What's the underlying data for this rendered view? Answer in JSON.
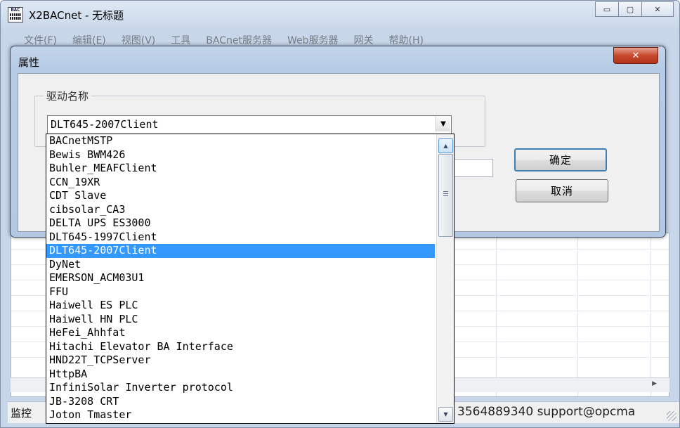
{
  "window": {
    "title": "X2BACnet - 无标题",
    "icon": "bac-app-icon",
    "icon_text": "BAC",
    "caption_buttons": {
      "minimize": "▭",
      "maximize": "▢",
      "close": "✕"
    }
  },
  "menubar": {
    "items": [
      "文件(F)",
      "编辑(E)",
      "视图(V)",
      "工具",
      "BACnet服务器",
      "Web服务器",
      "网关",
      "帮助(H)"
    ]
  },
  "statusbar": {
    "left": "监控",
    "right": "3564889340 support@opcma"
  },
  "dialog": {
    "title": "属性",
    "close_label": "✕",
    "group_label": "驱动名称",
    "combo_value": "DLT645-2007Client",
    "combo_arrow": "▼",
    "ok_label": "确定",
    "cancel_label": "取消"
  },
  "dropdown": {
    "selected_index": 8,
    "scroll_up": "▲",
    "scroll_down": "▼",
    "items": [
      "BACnetMSTP",
      "Bewis BWM426",
      "Buhler_MEAFClient",
      "CCN_19XR",
      "CDT Slave",
      "cibsolar_CA3",
      "DELTA UPS ES3000",
      "DLT645-1997Client",
      "DLT645-2007Client",
      "DyNet",
      "EMERSON_ACM03U1",
      "FFU",
      "Haiwell ES PLC",
      "Haiwell HN PLC",
      "HeFei_Ahhfat",
      "Hitachi Elevator BA Interface",
      "HND22T_TCPServer",
      "HttpBA",
      "InfiniSolar Inverter protocol",
      "JB-3208 CRT",
      "Joton Tmaster"
    ]
  },
  "colors": {
    "selection": "#3399ff",
    "dialog_frame": "#b6cbe5",
    "close_red": "#c8492e"
  }
}
